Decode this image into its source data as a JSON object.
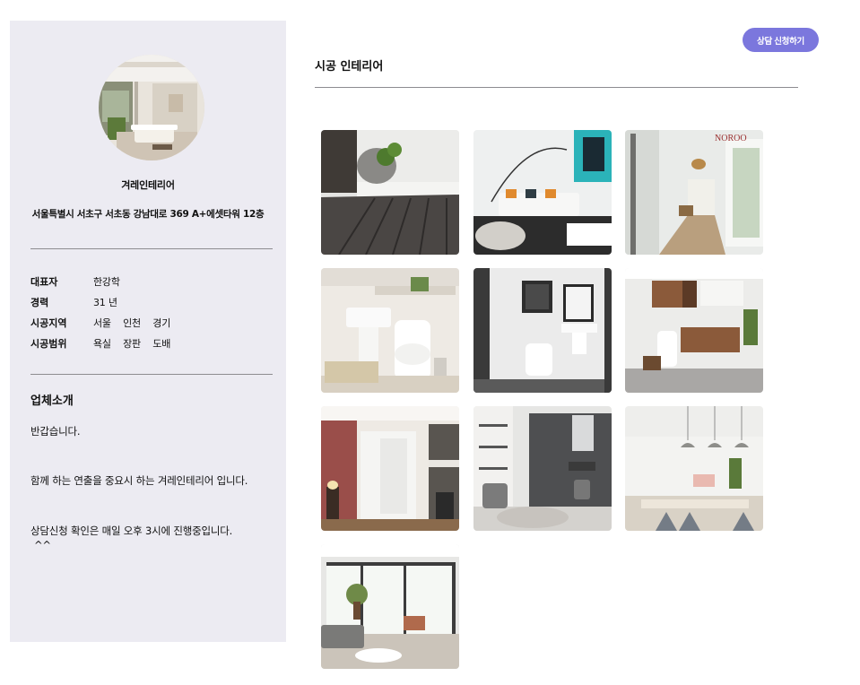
{
  "sidebar": {
    "company_name": "겨레인테리어",
    "address": "서울특별시 서초구 서초동 강남대로 369 A+에셋타워 12층",
    "info": [
      {
        "key": "대표자",
        "values": [
          "한강학"
        ]
      },
      {
        "key": "경력",
        "values": [
          "31 년"
        ]
      },
      {
        "key": "시공지역",
        "values": [
          "서울",
          "인천",
          "경기"
        ]
      },
      {
        "key": "시공범위",
        "values": [
          "욕실",
          "장판",
          "도배"
        ]
      }
    ],
    "intro_title": "업체소개",
    "intro_lines": [
      "반갑습니다.",
      "함께 하는 연출을 중요시 하는 겨레인테리어 입니다.",
      "상담신청 확인은 매일 오후 3시에 진행중입니다.",
      "^^"
    ]
  },
  "header": {
    "consult_button": "상담 신청하기",
    "section_title": "시공 인테리어"
  },
  "gallery": {
    "photos": [
      {
        "alt": "dark-wood-floor-photo",
        "overlay_text": ""
      },
      {
        "alt": "living-room-sofa-photo",
        "overlay_text": ""
      },
      {
        "alt": "hallway-photo",
        "overlay_text": "NOROO"
      },
      {
        "alt": "bathroom-white-photo",
        "overlay_text": ""
      },
      {
        "alt": "bathroom-dark-photo",
        "overlay_text": ""
      },
      {
        "alt": "bathroom-wood-vanity-photo",
        "overlay_text": ""
      },
      {
        "alt": "entrance-red-wall-photo",
        "overlay_text": ""
      },
      {
        "alt": "dressing-room-photo",
        "overlay_text": ""
      },
      {
        "alt": "dining-room-photo",
        "overlay_text": ""
      },
      {
        "alt": "living-room-window-photo",
        "overlay_text": ""
      }
    ]
  },
  "colors": {
    "sidebar_bg": "#ecebf2",
    "button_bg": "#7b77dd",
    "divider": "#8d8c90"
  }
}
